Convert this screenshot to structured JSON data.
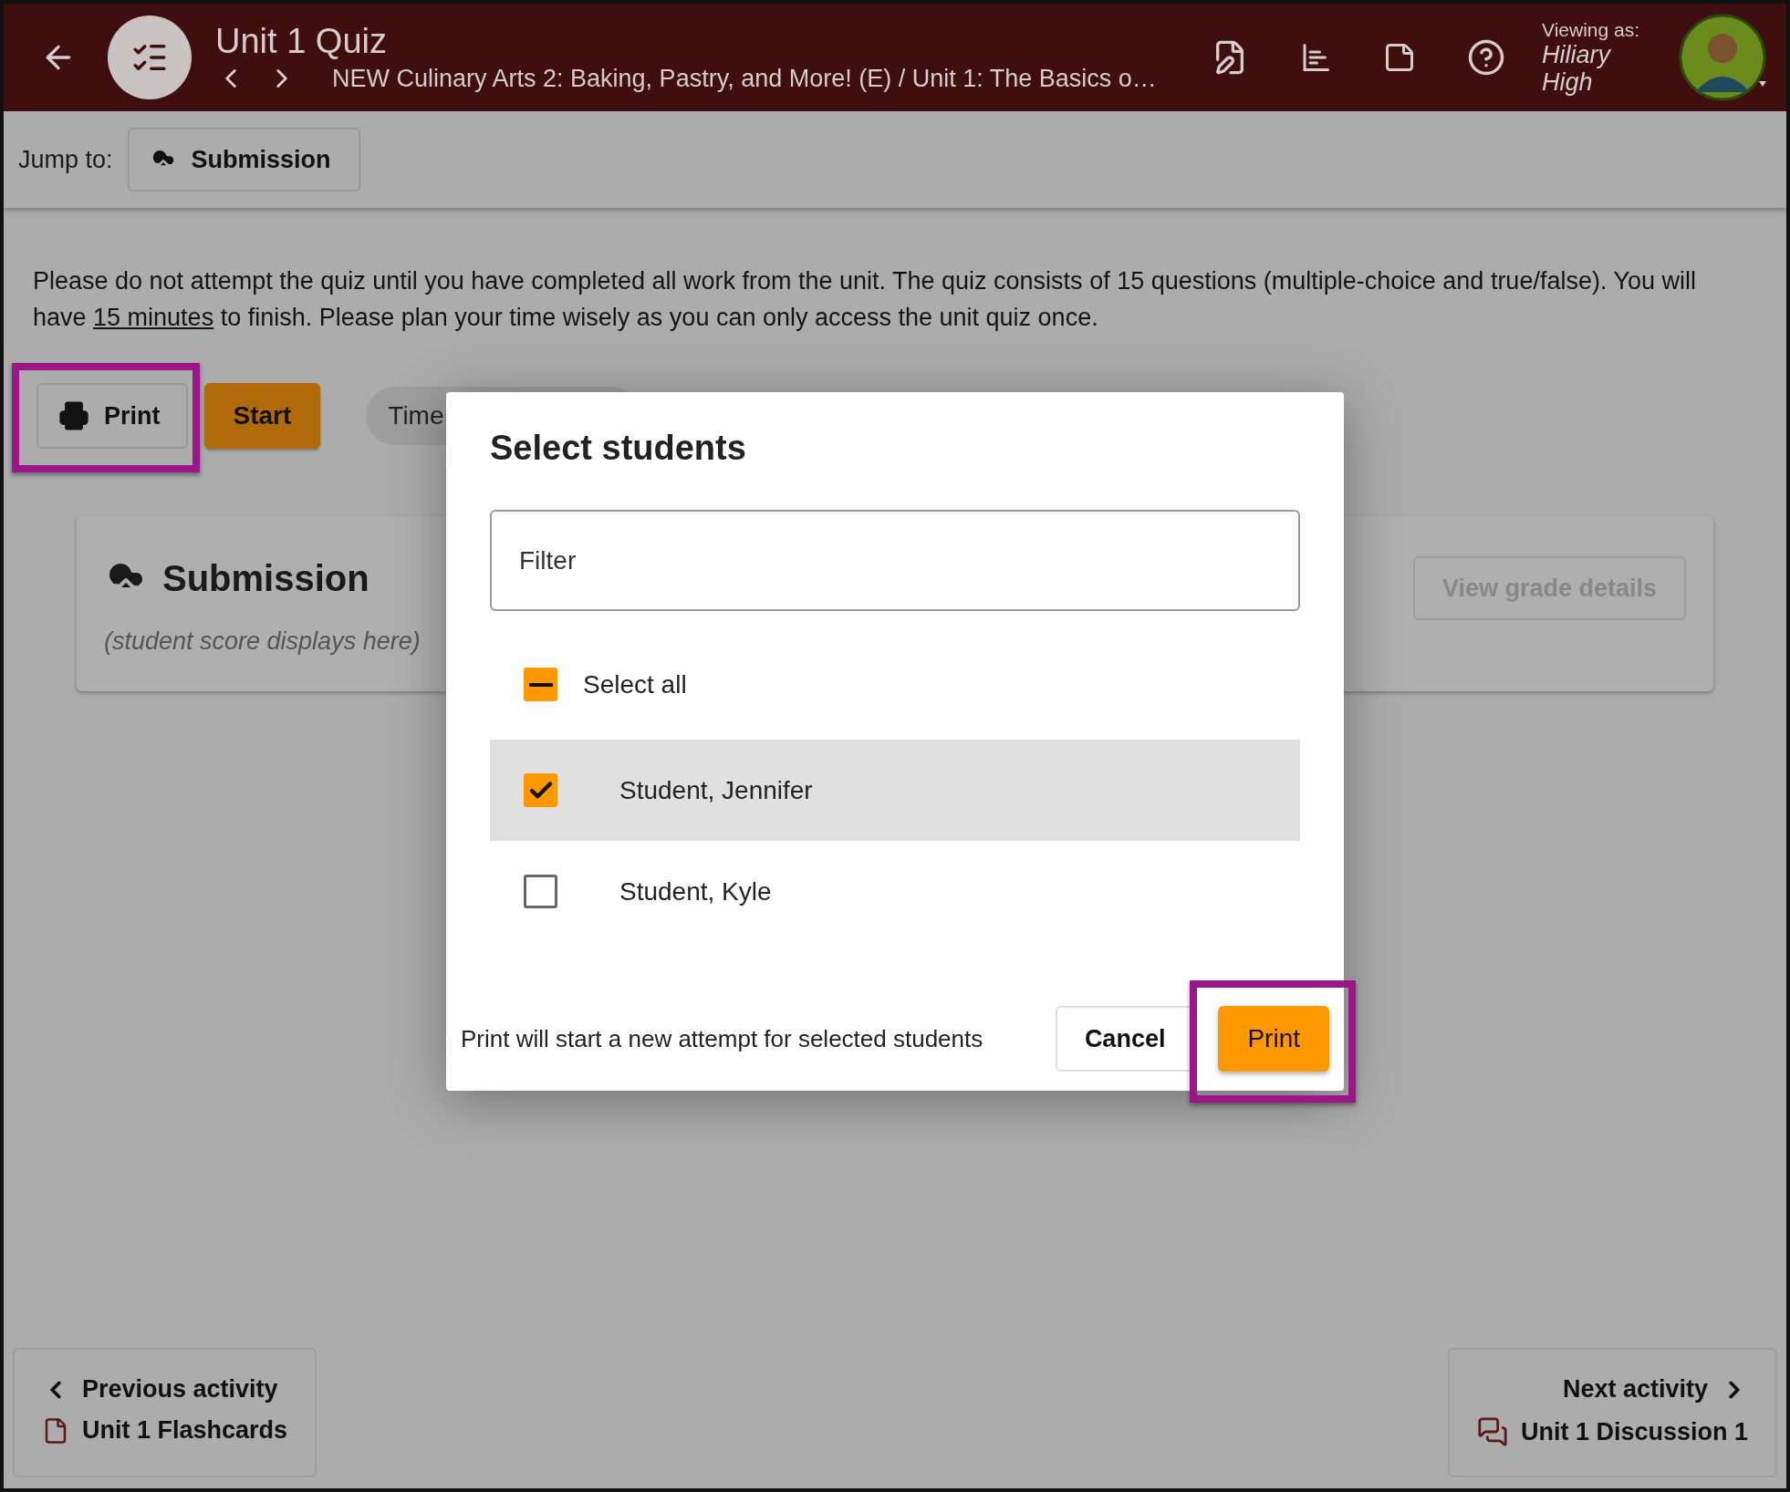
{
  "header": {
    "title": "Unit 1 Quiz",
    "breadcrumb": "NEW Culinary Arts 2: Baking, Pastry, and More! (E) / Unit 1: The Basics o…",
    "viewing_label": "Viewing as:",
    "viewing_name": "Hiliary High"
  },
  "jump_bar": {
    "label": "Jump to:",
    "button": "Submission"
  },
  "description": {
    "before": "Please do not attempt the quiz until you have completed all work from the unit. The quiz consists of 15 questions (multiple-choice and true/false). You will have ",
    "link": "15 minutes",
    "after": " to finish. Please plan your time wisely as you can only access the unit quiz once."
  },
  "actions": {
    "print": "Print",
    "start": "Start",
    "timer": "Time"
  },
  "submission_card": {
    "title": "Submission",
    "subtitle": "(student score displays here)",
    "button": "View grade details"
  },
  "dialog": {
    "title": "Select students",
    "filter": {
      "placeholder": "Filter"
    },
    "select_all": {
      "label": "Select all",
      "indeterminate": true
    },
    "students": [
      {
        "name": "Student, Jennifer",
        "checked": true,
        "selected": true
      },
      {
        "name": "Student, Kyle",
        "checked": false,
        "selected": false
      }
    ],
    "note": "Print will start a new attempt for selected students",
    "cancel": "Cancel",
    "confirm": "Print"
  },
  "footer_nav": {
    "previous": {
      "label": "Previous activity",
      "title": "Unit 1 Flashcards"
    },
    "next": {
      "label": "Next activity",
      "title": "Unit 1 Discussion 1"
    }
  }
}
